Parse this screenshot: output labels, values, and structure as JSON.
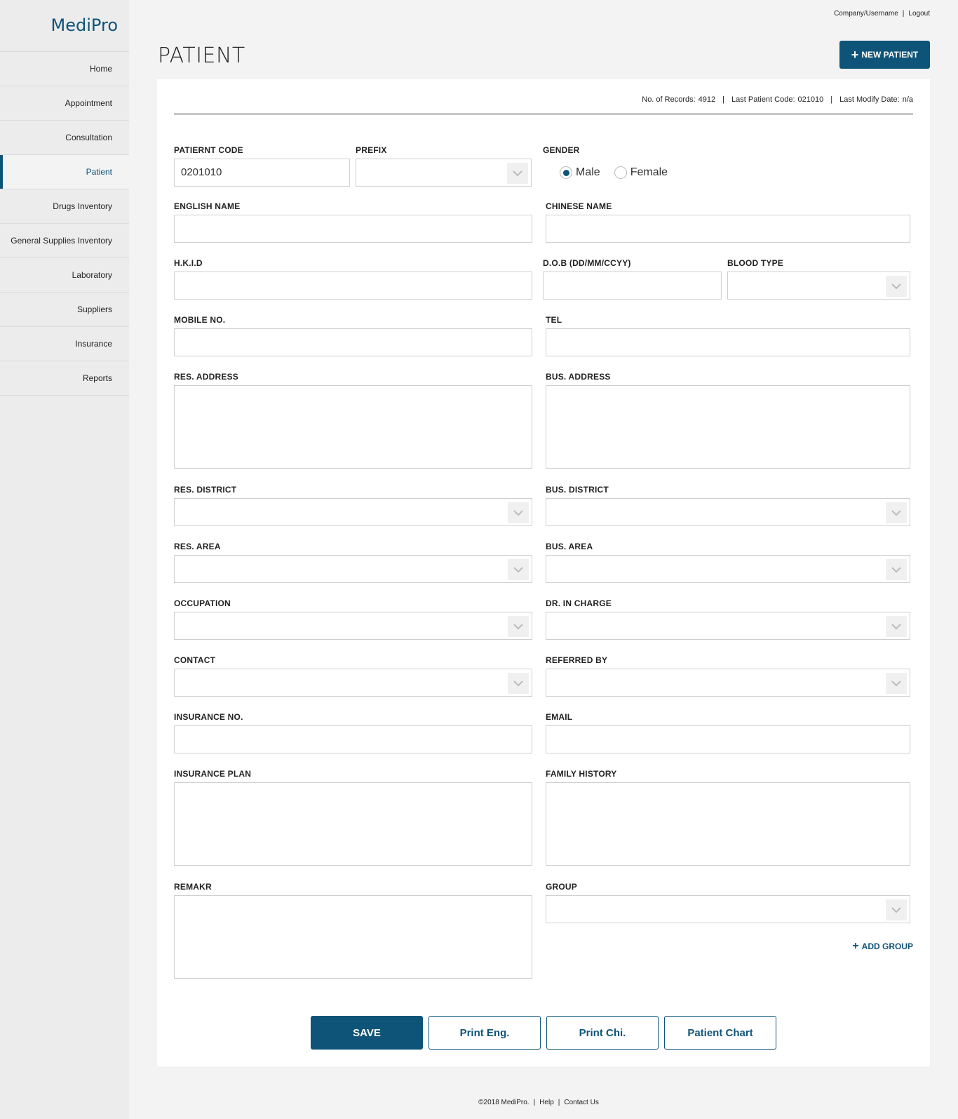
{
  "app": {
    "logo": "MediPro"
  },
  "sidebar": {
    "items": [
      {
        "label": "Home",
        "active": false
      },
      {
        "label": "Appointment",
        "active": false
      },
      {
        "label": "Consultation",
        "active": false
      },
      {
        "label": "Patient",
        "active": true
      },
      {
        "label": "Drugs Inventory",
        "active": false
      },
      {
        "label": "General Supplies Inventory",
        "active": false
      },
      {
        "label": "Laboratory",
        "active": false
      },
      {
        "label": "Suppliers",
        "active": false
      },
      {
        "label": "Insurance",
        "active": false
      },
      {
        "label": "Reports",
        "active": false
      }
    ]
  },
  "topbar": {
    "user": "Company/Username",
    "separator": "|",
    "logout": "Logout"
  },
  "header": {
    "title": "PATIENT",
    "new_button": "NEW PATIENT"
  },
  "stats": {
    "records_label": "No. of Records:",
    "records_value": "4912",
    "last_code_label": "Last Patient Code:",
    "last_code_value": "021010",
    "last_modify_label": "Last Modify Date:",
    "last_modify_value": "n/a",
    "separator": "|"
  },
  "form": {
    "patient_code": {
      "label": "PATIERNT CODE",
      "value": "0201010"
    },
    "prefix": {
      "label": "PREFIX",
      "value": ""
    },
    "gender": {
      "label": "GENDER",
      "options": [
        "Male",
        "Female"
      ],
      "selected": "Male"
    },
    "english_name": {
      "label": "ENGLISH NAME",
      "value": ""
    },
    "chinese_name": {
      "label": "CHINESE NAME",
      "value": ""
    },
    "hkid": {
      "label": "H.K.I.D",
      "value": ""
    },
    "dob": {
      "label": "D.O.B (DD/MM/CCYY)",
      "value": ""
    },
    "blood_type": {
      "label": "BLOOD TYPE",
      "value": ""
    },
    "mobile": {
      "label": "MOBILE NO.",
      "value": ""
    },
    "tel": {
      "label": "TEL",
      "value": ""
    },
    "res_address": {
      "label": "RES. ADDRESS",
      "value": ""
    },
    "bus_address": {
      "label": "BUS. ADDRESS",
      "value": ""
    },
    "res_district": {
      "label": "RES. DISTRICT",
      "value": ""
    },
    "bus_district": {
      "label": "BUS. DISTRICT",
      "value": ""
    },
    "res_area": {
      "label": "RES. AREA",
      "value": ""
    },
    "bus_area": {
      "label": "BUS. AREA",
      "value": ""
    },
    "occupation": {
      "label": "OCCUPATION",
      "value": ""
    },
    "dr_in_charge": {
      "label": "DR. IN CHARGE",
      "value": ""
    },
    "contact": {
      "label": "CONTACT",
      "value": ""
    },
    "referred_by": {
      "label": "REFERRED BY",
      "value": ""
    },
    "insurance_no": {
      "label": "INSURANCE NO.",
      "value": ""
    },
    "email": {
      "label": "EMAIL",
      "value": ""
    },
    "insurance_plan": {
      "label": "INSURANCE PLAN",
      "value": ""
    },
    "family_history": {
      "label": "FAMILY HISTORY",
      "value": ""
    },
    "remark": {
      "label": "REMAKR",
      "value": ""
    },
    "group": {
      "label": "GROUP",
      "value": ""
    },
    "add_group": "ADD GROUP"
  },
  "actions": {
    "save": "SAVE",
    "print_eng": "Print Eng.",
    "print_chi": "Print Chi.",
    "patient_chart": "Patient Chart"
  },
  "footer": {
    "copyright": "©2018 MediPro.",
    "help": "Help",
    "contact": "Contact Us",
    "separator": "|"
  },
  "colors": {
    "accent": "#0e5478",
    "sidebar_bg": "#ececec",
    "page_bg": "#f3f3f3"
  },
  "icons": {
    "new": "plus-icon",
    "add_group": "plus-icon",
    "select": "chevron-down-icon"
  }
}
